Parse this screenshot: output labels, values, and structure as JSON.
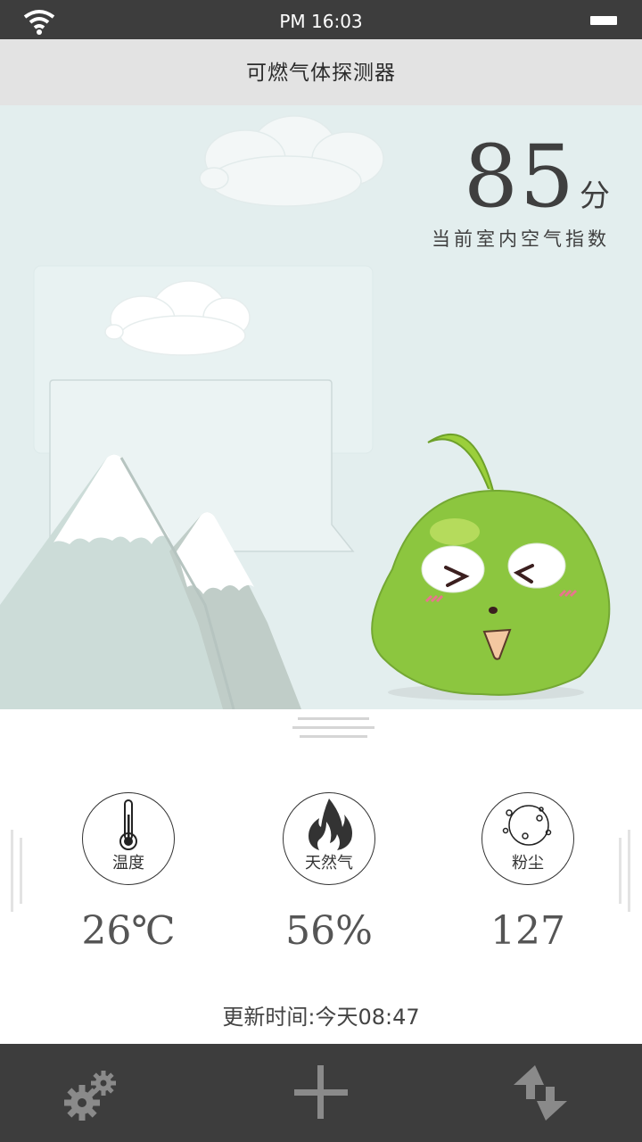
{
  "status_bar": {
    "time": "PM 16:03",
    "icons": [
      "wifi-icon",
      "battery-icon"
    ]
  },
  "header": {
    "title": "可燃气体探测器"
  },
  "air_index": {
    "score": "85",
    "unit": "分",
    "label": "当前室内空气指数"
  },
  "metrics": [
    {
      "id": "temperature",
      "icon": "thermometer-icon",
      "caption": "温度",
      "value": "26℃"
    },
    {
      "id": "natural-gas",
      "icon": "flame-icon",
      "caption": "天然气",
      "value": "56%"
    },
    {
      "id": "dust",
      "icon": "dust-particles-icon",
      "caption": "粉尘",
      "value": "127"
    }
  ],
  "update": {
    "text": "更新时间:今天08:47"
  },
  "toolbar": {
    "buttons": [
      "settings-icon",
      "add-icon",
      "refresh-icon"
    ]
  },
  "colors": {
    "status_bar": "#3d3d3d",
    "title_bar": "#e3e3e3",
    "scene_bg": "#e3eeee",
    "mascot_green": "#8cc63f",
    "toolbar": "#3d3d3d",
    "icon_gray": "#8a8a8a"
  }
}
